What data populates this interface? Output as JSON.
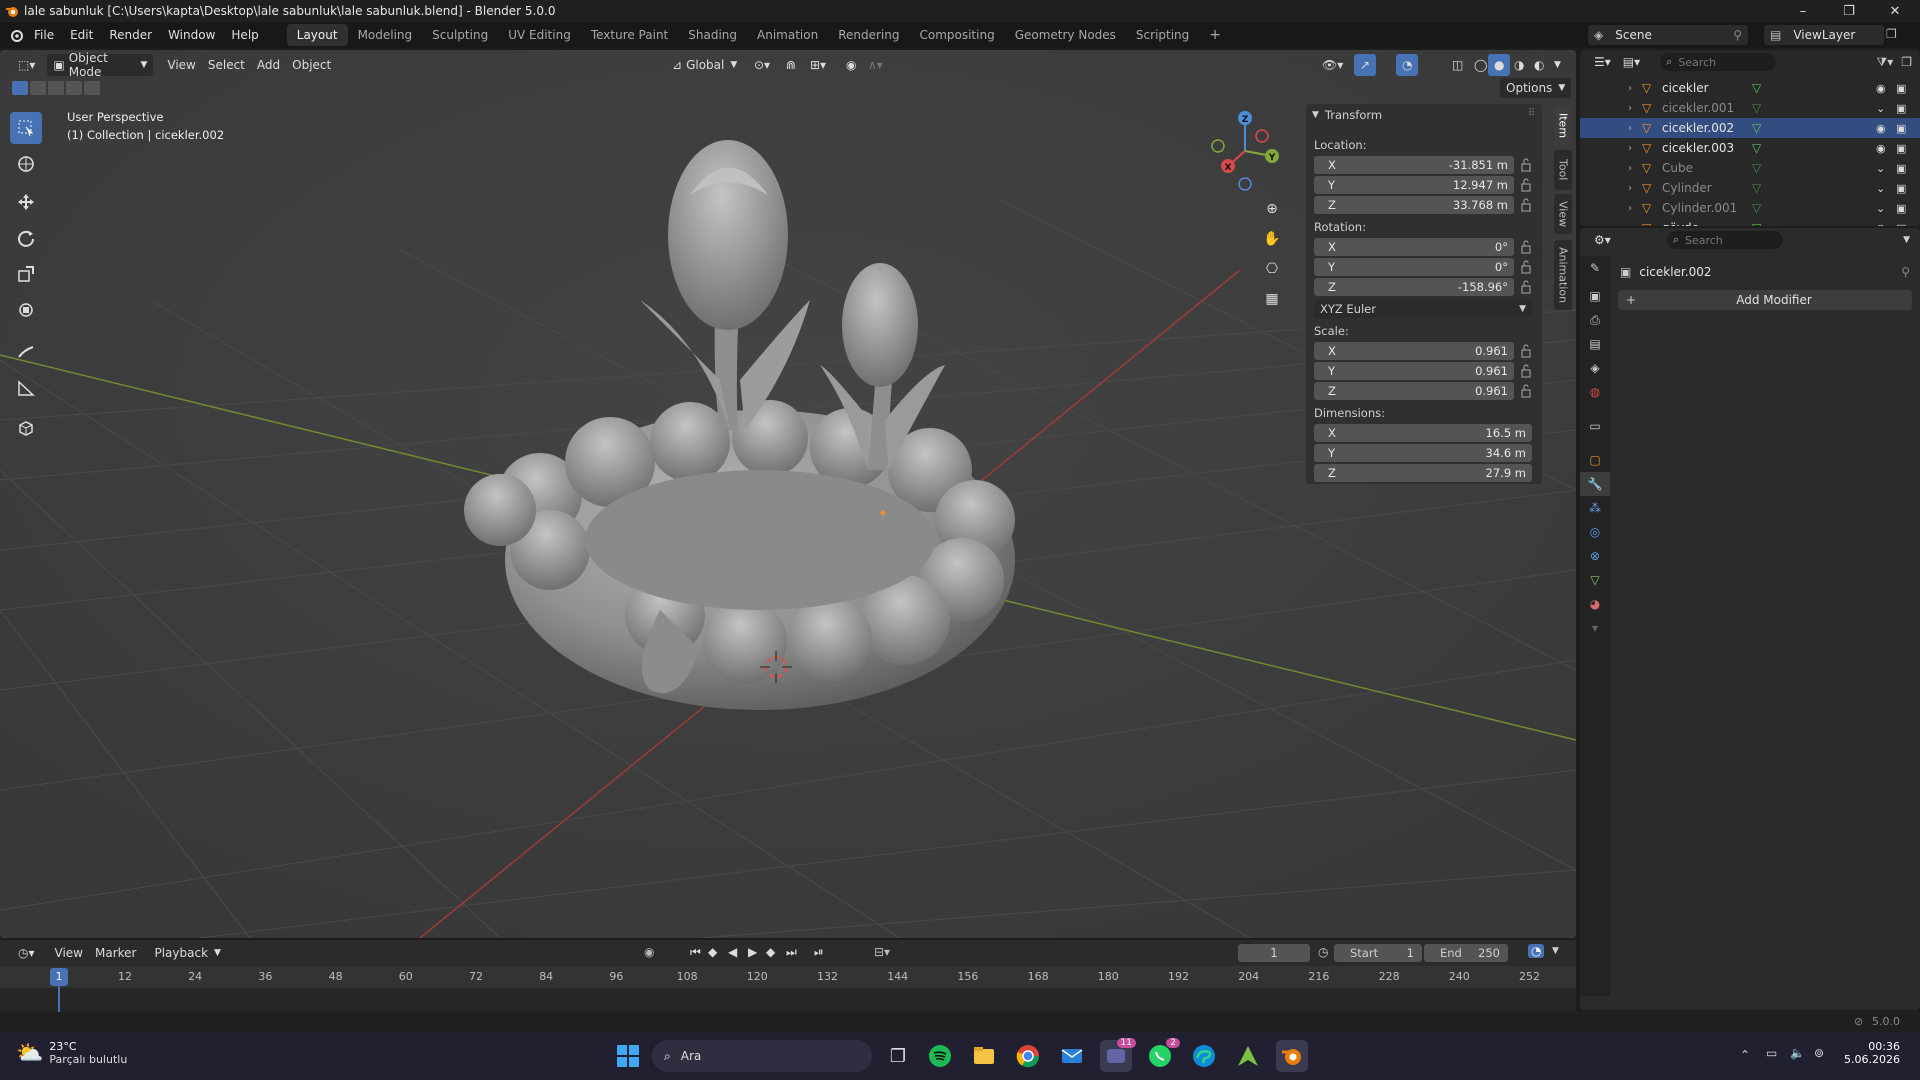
{
  "window": {
    "title": "lale sabunluk [C:\\Users\\kapta\\Desktop\\lale sabunluk\\lale sabunluk.blend] - Blender 5.0.0"
  },
  "menu": {
    "items": [
      "File",
      "Edit",
      "Render",
      "Window",
      "Help"
    ],
    "workspaces": [
      "Layout",
      "Modeling",
      "Sculpting",
      "UV Editing",
      "Texture Paint",
      "Shading",
      "Animation",
      "Rendering",
      "Compositing",
      "Geometry Nodes",
      "Scripting"
    ],
    "active_workspace": "Layout"
  },
  "scene": {
    "name": "Scene",
    "view_layer": "ViewLayer"
  },
  "viewport_header": {
    "mode": "Object Mode",
    "menus": [
      "View",
      "Select",
      "Add",
      "Object"
    ],
    "orientation": "Global",
    "options_label": "Options"
  },
  "viewport": {
    "perspective": "User Perspective",
    "collection_info": "(1) Collection | cicekler.002",
    "gizmo_axes": [
      "X",
      "Y",
      "Z"
    ]
  },
  "npanel": {
    "section": "Transform",
    "location_label": "Location:",
    "location": [
      {
        "axis": "X",
        "value": "-31.851 m"
      },
      {
        "axis": "Y",
        "value": "12.947 m"
      },
      {
        "axis": "Z",
        "value": "33.768 m"
      }
    ],
    "rotation_label": "Rotation:",
    "rotation": [
      {
        "axis": "X",
        "value": "0°"
      },
      {
        "axis": "Y",
        "value": "0°"
      },
      {
        "axis": "Z",
        "value": "-158.96°"
      }
    ],
    "rotation_mode": "XYZ Euler",
    "scale_label": "Scale:",
    "scale": [
      {
        "axis": "X",
        "value": "0.961"
      },
      {
        "axis": "Y",
        "value": "0.961"
      },
      {
        "axis": "Z",
        "value": "0.961"
      }
    ],
    "dimensions_label": "Dimensions:",
    "dimensions": [
      {
        "axis": "X",
        "value": "16.5 m"
      },
      {
        "axis": "Y",
        "value": "34.6 m"
      },
      {
        "axis": "Z",
        "value": "27.9 m"
      }
    ],
    "tabs": [
      "Item",
      "Tool",
      "View",
      "Animation"
    ]
  },
  "outliner": {
    "search_placeholder": "Search",
    "items": [
      {
        "name": "cicekler",
        "visible": true
      },
      {
        "name": "cicekler.001",
        "visible": false
      },
      {
        "name": "cicekler.002",
        "visible": true,
        "selected": true
      },
      {
        "name": "cicekler.003",
        "visible": true
      },
      {
        "name": "Cube",
        "visible": false
      },
      {
        "name": "Cylinder",
        "visible": false
      },
      {
        "name": "Cylinder.001",
        "visible": false
      },
      {
        "name": "gövde",
        "visible": true
      }
    ]
  },
  "properties": {
    "search_placeholder": "Search",
    "object_name": "cicekler.002",
    "add_modifier_label": "Add Modifier"
  },
  "timeline": {
    "menus": [
      "View",
      "Marker"
    ],
    "playback_label": "Playback",
    "current_frame": "1",
    "start_label": "Start",
    "start": "1",
    "end_label": "End",
    "end": "250",
    "ticks": [
      "12",
      "24",
      "36",
      "48",
      "60",
      "72",
      "84",
      "96",
      "108",
      "120",
      "132",
      "144",
      "156",
      "168",
      "180",
      "192",
      "204",
      "216",
      "228",
      "240",
      "252"
    ],
    "playhead": "1"
  },
  "statusbar": {
    "version": "5.0.0"
  },
  "taskbar": {
    "weather_temp": "23°C",
    "weather_desc": "Parçalı bulutlu",
    "search_label": "Ara",
    "time": "00:36",
    "date": "5.06.2026",
    "badge_teams": "11",
    "badge_whatsapp": "2"
  },
  "colors": {
    "accent": "#4772b3",
    "selection": "#e8922e",
    "x_axis": "#d94b4b",
    "y_axis": "#82a83a",
    "z_axis": "#4c8ed9"
  }
}
